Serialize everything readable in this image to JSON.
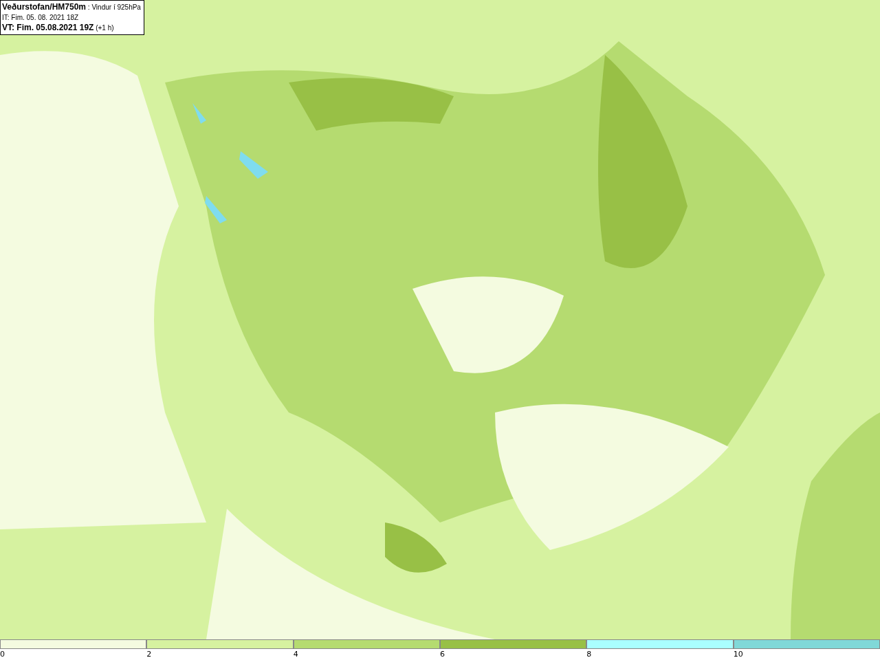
{
  "info_box": {
    "source": "Veðurstofan/HM750m",
    "parameter": ": Vindur í 925hPa",
    "initial_time": "IT: Fim. 05. 08. 2021 18Z",
    "valid_time": "VT: Fim. 05.08.2021 19Z",
    "offset": "(+1 h)"
  },
  "legend": [
    {
      "label": "0",
      "color": "#f4fbe0"
    },
    {
      "label": "2",
      "color": "#d6f2a0"
    },
    {
      "label": "4",
      "color": "#b5db70"
    },
    {
      "label": "6",
      "color": "#98c046"
    },
    {
      "label": "8",
      "color": "#aaffff"
    },
    {
      "label": "10",
      "color": "#80d8d8"
    }
  ]
}
